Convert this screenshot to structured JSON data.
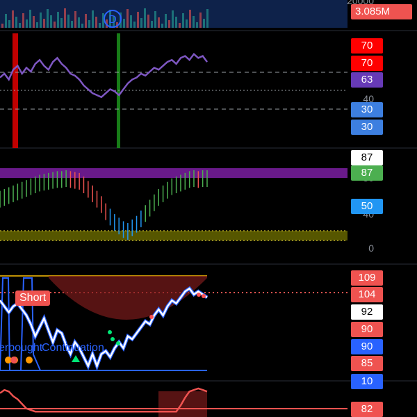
{
  "chart_data": [
    {
      "type": "bar",
      "panel": "volume",
      "price_axis_label": "20000",
      "last_value_label": "3.085M",
      "marker_label": "D",
      "colors": {
        "up": "#26a69a",
        "down": "#ef5350",
        "badge": "#ef5350",
        "band": "#14306a"
      }
    },
    {
      "type": "line",
      "panel": "rsi",
      "axis_labels": [
        "40"
      ],
      "series": [
        {
          "values": [
            56,
            58,
            55,
            60,
            62,
            58,
            61,
            59,
            63,
            65,
            62,
            60,
            64,
            66,
            63,
            61,
            58,
            57,
            55,
            52,
            50,
            48,
            47,
            46,
            48,
            50,
            49,
            47,
            50,
            53,
            55,
            56,
            58,
            57,
            59,
            61,
            60,
            62,
            64,
            65,
            63,
            66,
            67,
            65,
            68,
            66,
            67,
            64
          ]
        }
      ],
      "levels": {
        "upper": 70,
        "lower": 30,
        "mid": 50
      },
      "badges": [
        {
          "label": "70",
          "color": "#ff0000"
        },
        {
          "label": "70",
          "color": "#ff0000"
        },
        {
          "label": "63",
          "color": "#673ab7"
        },
        {
          "label": "30",
          "color": "#3d7fe0"
        },
        {
          "label": "30",
          "color": "#3d7fe0"
        }
      ],
      "highlight_colors": [
        "#d50000",
        "#1b8a1b"
      ]
    },
    {
      "type": "bar",
      "panel": "stochastic-histogram",
      "axis_labels": [
        "50",
        "40",
        "0"
      ],
      "values": [
        64,
        66,
        68,
        70,
        72,
        74,
        76,
        78,
        80,
        82,
        83,
        84,
        85,
        86,
        86,
        87,
        86,
        85,
        84,
        80,
        75,
        70,
        64,
        58,
        50,
        44,
        38,
        34,
        30,
        28,
        32,
        36,
        42,
        48,
        54,
        60,
        66,
        70,
        74,
        78,
        80,
        82,
        84,
        86,
        87,
        86,
        87,
        87
      ],
      "upper_band": [
        78,
        86
      ],
      "lower_band": [
        0,
        4
      ],
      "badges": [
        {
          "label": "87",
          "color": "#ffffff"
        },
        {
          "label": "87",
          "color": "#4caf50"
        },
        {
          "label": "50",
          "color": "#2196f3"
        }
      ]
    },
    {
      "type": "line",
      "panel": "oscillator",
      "series": [
        {
          "values": [
            102,
            100,
            98,
            100,
            101,
            99,
            97,
            94,
            90,
            93,
            96,
            92,
            88,
            92,
            91,
            87,
            84,
            88,
            86,
            83,
            80,
            84,
            80,
            84,
            85,
            83,
            86,
            88,
            86,
            90,
            89,
            91,
            93,
            95,
            94,
            97,
            99,
            97,
            100,
            102,
            101,
            103,
            105,
            106,
            104,
            105,
            104,
            103
          ]
        }
      ],
      "ylim": [
        75,
        110
      ],
      "annotations": [
        "Short",
        "erbought",
        "Continuation"
      ],
      "badges": [
        {
          "label": "109",
          "color": "#ef5350"
        },
        {
          "label": "104",
          "color": "#ef5350"
        },
        {
          "label": "92",
          "color": "#ffffff"
        },
        {
          "label": "90",
          "color": "#ef5350"
        },
        {
          "label": "90",
          "color": "#2962ff"
        },
        {
          "label": "85",
          "color": "#ef5350"
        },
        {
          "label": "10",
          "color": "#2962ff"
        }
      ]
    },
    {
      "type": "line",
      "panel": "bottom",
      "series": [
        {
          "values": [
            76,
            80,
            78,
            72,
            68,
            62,
            56,
            54,
            52,
            52,
            52,
            52,
            52,
            52,
            52,
            52,
            52,
            52,
            52,
            52,
            52,
            52,
            52,
            52,
            52,
            52,
            52,
            52,
            52,
            52,
            52,
            52,
            52,
            52,
            52,
            52,
            52,
            52,
            52,
            52,
            52,
            60,
            70,
            78,
            80,
            82,
            80,
            78
          ]
        }
      ],
      "ylim": [
        45,
        90
      ],
      "badges": [
        {
          "label": "82",
          "color": "#ef5350"
        }
      ]
    }
  ]
}
